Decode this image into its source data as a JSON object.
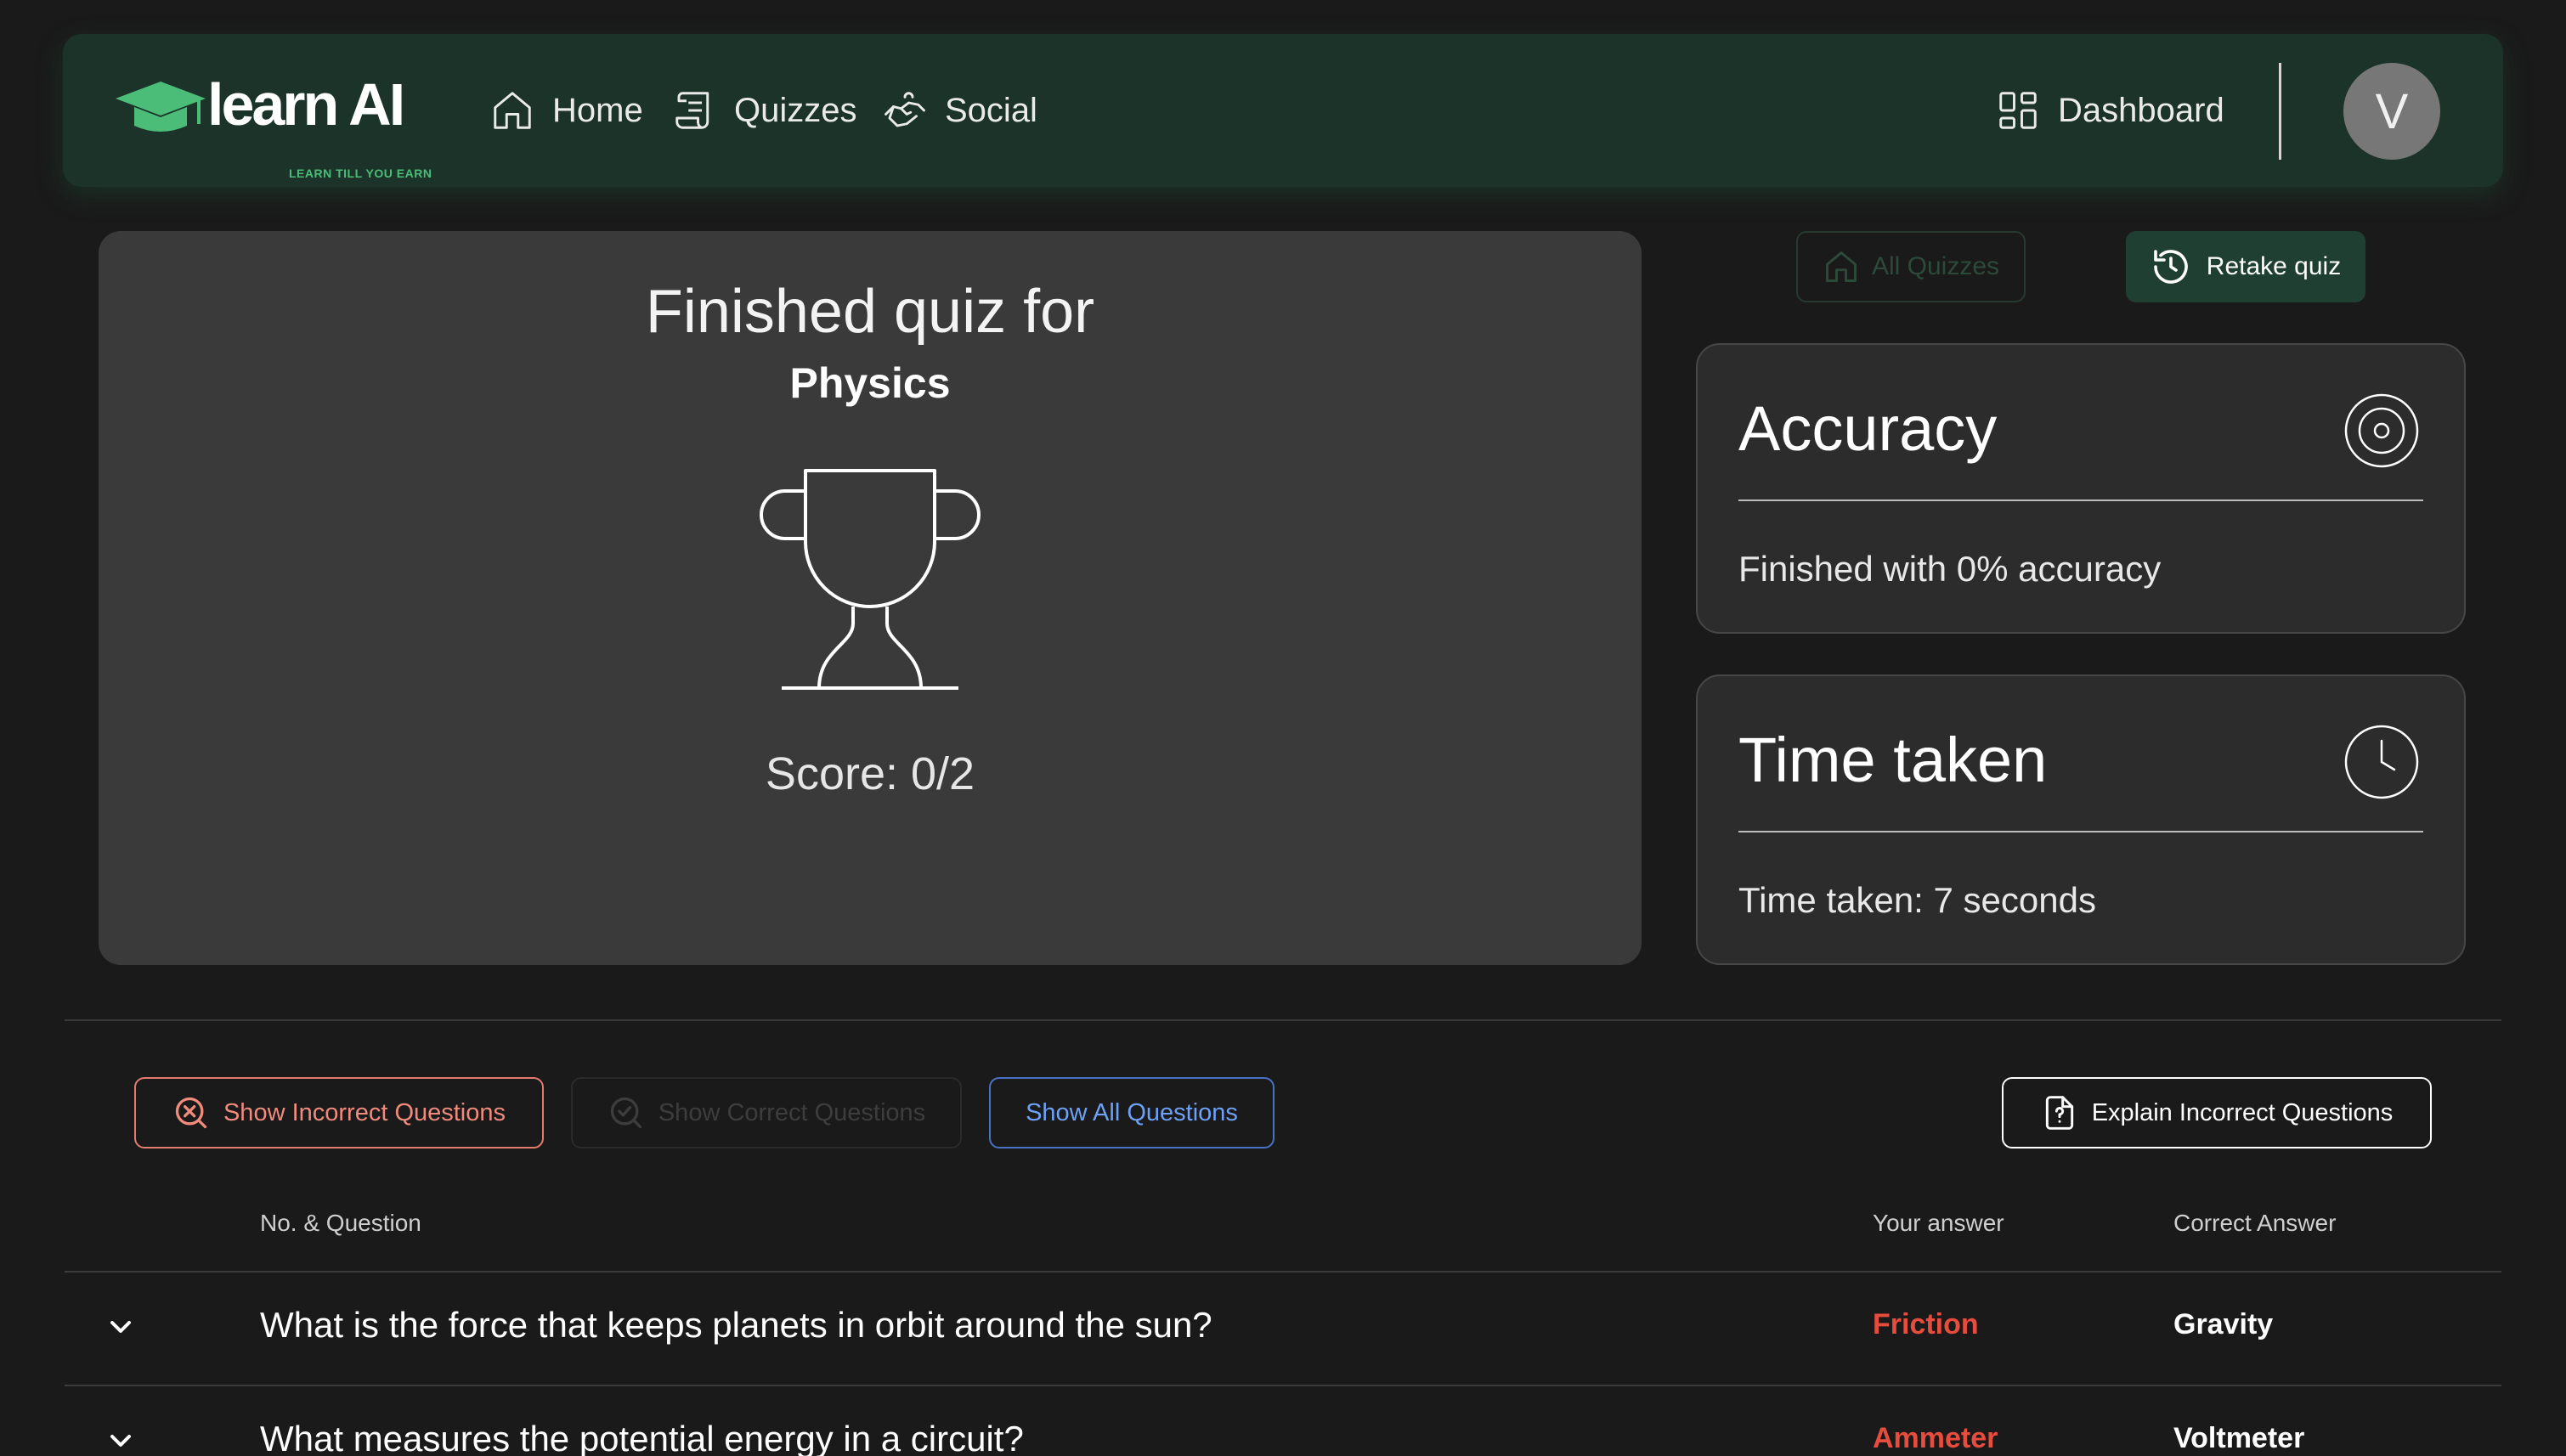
{
  "brand": {
    "name": "learn AI",
    "tagline": "LEARN TILL YOU EARN",
    "accent_color": "#4cbc79"
  },
  "nav": {
    "home": "Home",
    "quizzes": "Quizzes",
    "social": "Social",
    "dashboard": "Dashboard",
    "avatar_initial": "V"
  },
  "result": {
    "title": "Finished quiz for",
    "subject": "Physics",
    "score": "Score: 0/2"
  },
  "actions": {
    "all_quizzes": "All Quizzes",
    "retake": "Retake quiz"
  },
  "stats": {
    "accuracy": {
      "title": "Accuracy",
      "value": "Finished with 0% accuracy"
    },
    "time": {
      "title": "Time taken",
      "value": "Time taken: 7 seconds"
    }
  },
  "filters": {
    "incorrect": "Show Incorrect Questions",
    "correct": "Show Correct Questions",
    "all": "Show All Questions",
    "explain": "Explain Incorrect Questions"
  },
  "table": {
    "headers": {
      "question": "No. & Question",
      "your_answer": "Your answer",
      "correct_answer": "Correct Answer"
    },
    "rows": [
      {
        "question": "What is the force that keeps planets in orbit around the sun?",
        "your_answer": "Friction",
        "correct_answer": "Gravity"
      },
      {
        "question": "What measures the potential energy in a circuit?",
        "your_answer": "Ammeter",
        "correct_answer": "Voltmeter"
      }
    ]
  },
  "icons": {
    "home": "home-icon",
    "quizzes": "scroll-icon",
    "social": "handshake-icon",
    "dashboard": "dashboard-grid-icon",
    "retake": "history-icon",
    "accuracy": "target-icon",
    "time": "clock-icon",
    "incorrect": "search-x-icon",
    "correct": "search-check-icon",
    "explain": "file-question-icon",
    "row_toggle": "chevron-down-icon"
  }
}
